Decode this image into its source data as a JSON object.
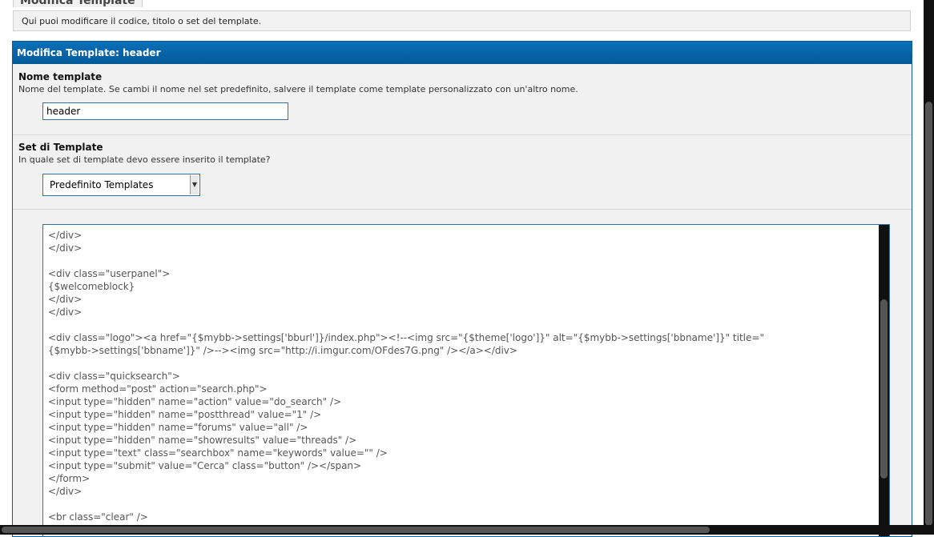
{
  "page": {
    "title": "Modifica Template",
    "description": "Qui puoi modificare il codice, titolo o set del template."
  },
  "panel": {
    "header": "Modifica Template: header",
    "name_section": {
      "title": "Nome template",
      "description": "Nome del template. Se cambi il nome nel set predefinito, salvere il template come template personalizzato con un'altro nome.",
      "value": "header"
    },
    "set_section": {
      "title": "Set di Template",
      "description": "In quale set di template devo essere inserito il template?",
      "selected": "Predefinito Templates"
    },
    "code": "</div>\n</div>\n\n<div class=\"userpanel\">\n{$welcomeblock}\n</div>\n</div>\n\n<div class=\"logo\"><a href=\"{$mybb->settings['bburl']}/index.php\"><!--<img src=\"{$theme['logo']}\" alt=\"{$mybb->settings['bbname']}\" title=\"\n{$mybb->settings['bbname']}\" />--><img src=\"http://i.imgur.com/OFdes7G.png\" /></a></div>\n\n<div class=\"quicksearch\">\n<form method=\"post\" action=\"search.php\">\n<input type=\"hidden\" name=\"action\" value=\"do_search\" />\n<input type=\"hidden\" name=\"postthread\" value=\"1\" />\n<input type=\"hidden\" name=\"forums\" value=\"all\" />\n<input type=\"hidden\" name=\"showresults\" value=\"threads\" />\n<input type=\"text\" class=\"searchbox\" name=\"keywords\" value=\"\" />\n<input type=\"submit\" value=\"Cerca\" class=\"button\" /></span>\n</form>\n</div>\n\n<br class=\"clear\" />"
  }
}
